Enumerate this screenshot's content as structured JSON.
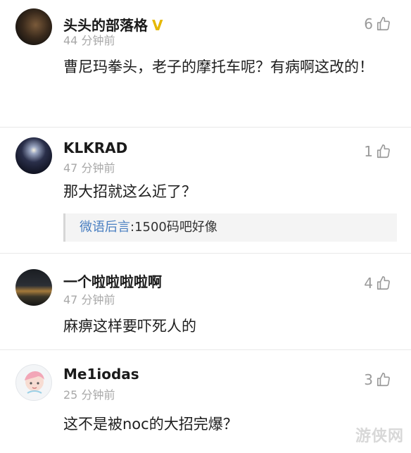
{
  "comments": [
    {
      "username": "头头的部落格",
      "verified": "V",
      "time": "44 分钟前",
      "likes": "6",
      "text": "曹尼玛拳头，老子的摩托车呢？有病啊这改的！"
    },
    {
      "username": "KLKRAD",
      "time": "47 分钟前",
      "likes": "1",
      "text": "那大招就这么近了？",
      "reply": {
        "user": "微语后言",
        "text": ":1500码吧好像"
      }
    },
    {
      "username": "一个啦啦啦啦啊",
      "time": "47 分钟前",
      "likes": "4",
      "text": "麻痹这样要吓死人的"
    },
    {
      "username": "Me1iodas",
      "time": "25 分钟前",
      "likes": "3",
      "text": "这不是被noc的大招完爆？"
    }
  ],
  "icons": {
    "like": "thumbs-up-icon"
  },
  "colors": {
    "reply_user": "#4a7fc1",
    "verified": "#e6b800",
    "meta": "#a8a8a8"
  },
  "watermark": "游侠网"
}
